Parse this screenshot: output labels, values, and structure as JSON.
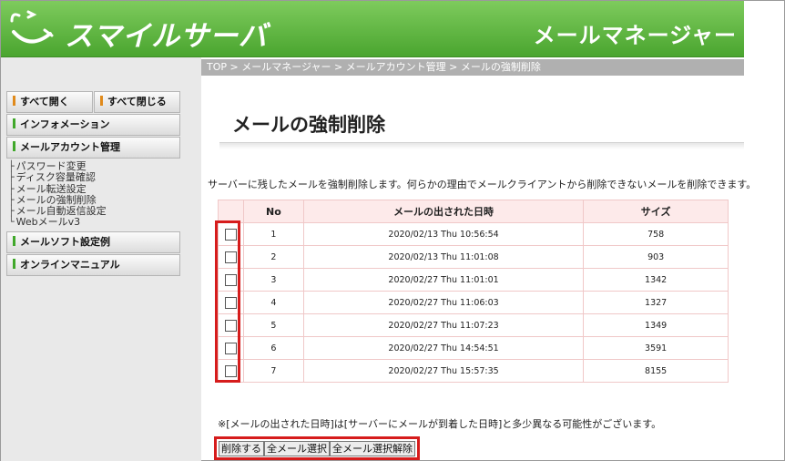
{
  "header": {
    "logo_text": "スマイルサーバ",
    "title": "メールマネージャー",
    "brand_color": "#4aa52f"
  },
  "breadcrumb": "TOP > メールマネージャー > メールアカウント管理 > メールの強制削除",
  "sidebar": {
    "open_all": "すべて開く",
    "close_all": "すべて閉じる",
    "information": "インフォメーション",
    "mail_account": "メールアカウント管理",
    "subitems": [
      "パスワード変更",
      "ディスク容量確認",
      "メール転送設定",
      "メールの強制削除",
      "メール自動返信設定",
      "Webメールv3"
    ],
    "mail_soft": "メールソフト設定例",
    "online_manual": "オンラインマニュアル"
  },
  "main": {
    "title": "メールの強制削除",
    "description": "サーバーに残したメールを強制削除します。何らかの理由でメールクライアントから削除できないメールを削除できます。",
    "table": {
      "headers": [
        "",
        "No",
        "メールの出された日時",
        "サイズ"
      ],
      "rows": [
        {
          "no": "1",
          "datetime": "2020/02/13 Thu 10:56:54",
          "size": "758"
        },
        {
          "no": "2",
          "datetime": "2020/02/13 Thu 11:01:08",
          "size": "903"
        },
        {
          "no": "3",
          "datetime": "2020/02/27 Thu 11:01:01",
          "size": "1342"
        },
        {
          "no": "4",
          "datetime": "2020/02/27 Thu 11:06:03",
          "size": "1327"
        },
        {
          "no": "5",
          "datetime": "2020/02/27 Thu 11:07:23",
          "size": "1349"
        },
        {
          "no": "6",
          "datetime": "2020/02/27 Thu 14:54:51",
          "size": "3591"
        },
        {
          "no": "7",
          "datetime": "2020/02/27 Thu 15:57:35",
          "size": "8155"
        }
      ]
    },
    "note": "※[メールの出された日時]は[サーバーにメールが到着した日時]と多少異なる可能性がございます。",
    "buttons": {
      "delete": "削除する",
      "select_all": "全メール選択",
      "deselect_all": "全メール選択解除"
    }
  }
}
